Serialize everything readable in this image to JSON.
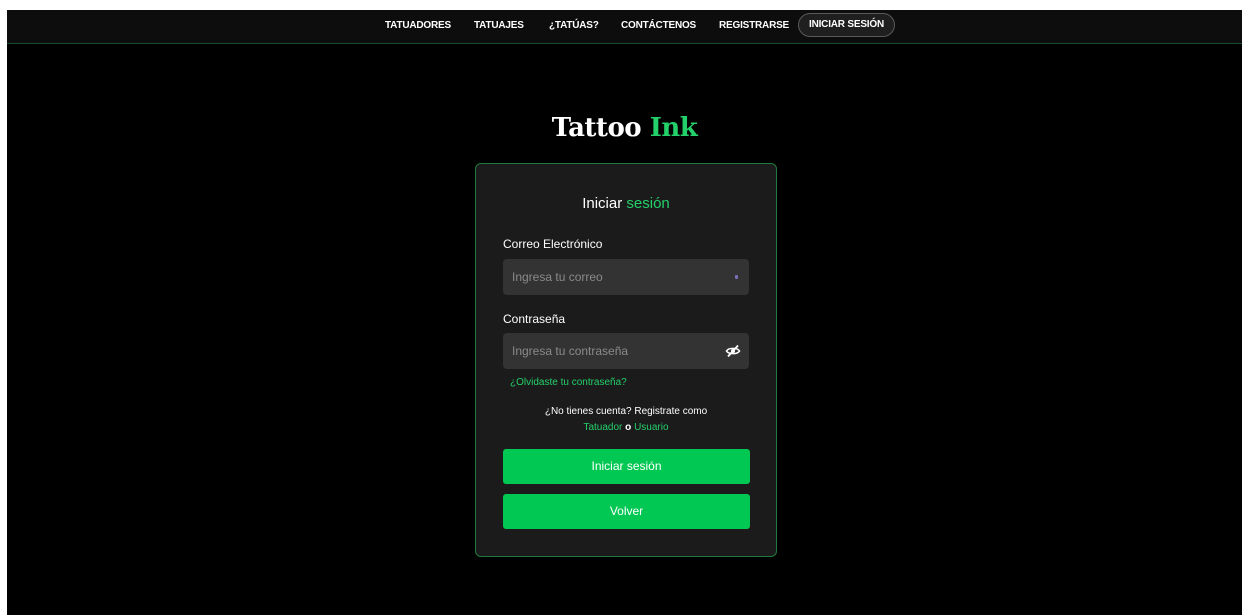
{
  "nav": {
    "items": [
      {
        "label": "TATUADORES"
      },
      {
        "label": "TATUAJES"
      },
      {
        "label": "¿TATÚAS?"
      },
      {
        "label": "CONTÁCTENOS"
      },
      {
        "label": "REGISTRARSE"
      },
      {
        "label": "INICIAR SESIÓN",
        "active": true
      }
    ]
  },
  "logo": {
    "part1": "Tattoo ",
    "part2": "Ink"
  },
  "login": {
    "title_part1": "Iniciar ",
    "title_part2": "sesión",
    "email_label": "Correo Electrónico",
    "email_placeholder": "Ingresa tu correo",
    "email_value": "",
    "email_icon": "mail-icon",
    "password_label": "Contraseña",
    "password_placeholder": "Ingresa tu contraseña",
    "password_value": "",
    "password_icon": "eye-slash-icon",
    "forgot": "¿Olvidaste tu contraseña?",
    "no_account": "¿No tienes cuenta? Registrate como",
    "register_tattooist": "Tatuador",
    "register_or": "o",
    "register_user": "Usuario",
    "submit_button": "Iniciar sesión",
    "back_button": "Volver"
  },
  "colors": {
    "accent": "#23d06a",
    "button": "#00c853",
    "background": "#000000",
    "card": "#1b1b1b",
    "input": "#333333"
  }
}
